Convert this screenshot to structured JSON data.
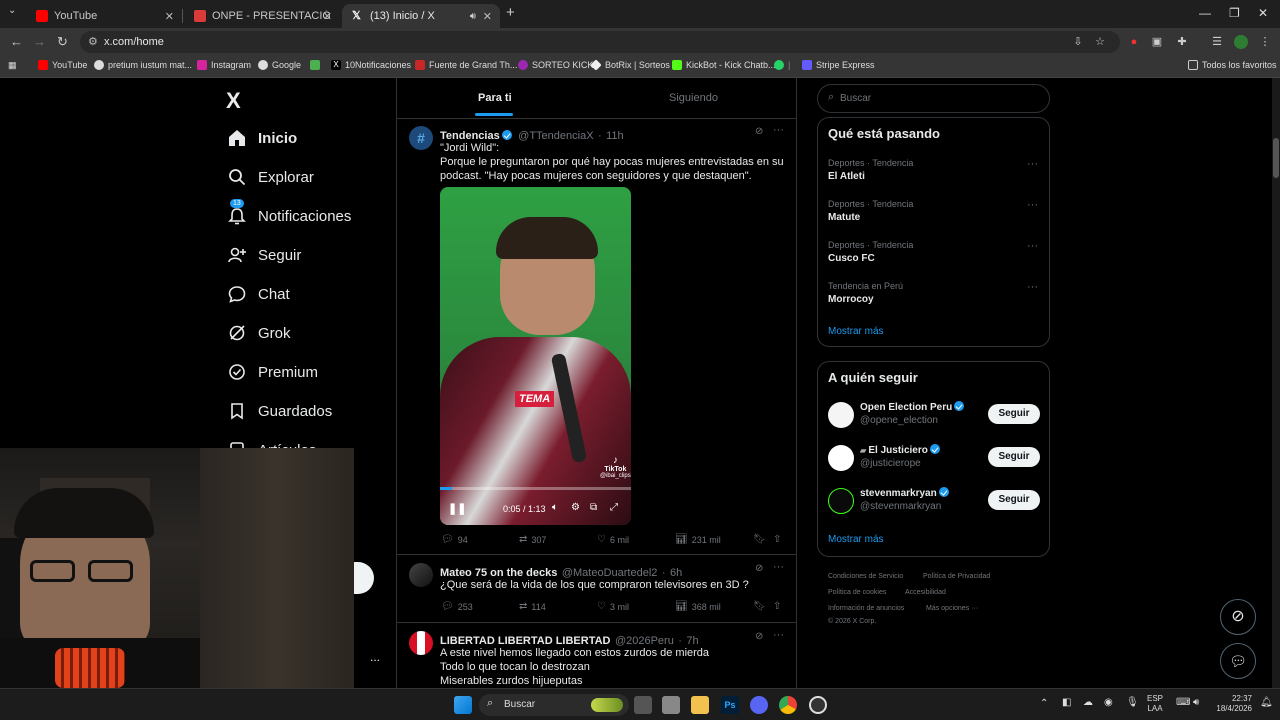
{
  "browser": {
    "tabs": [
      {
        "title": "YouTube",
        "favicon_color": "#ff0000"
      },
      {
        "title": "ONPE - PRESENTACIÓN DE RES",
        "favicon_color": "#d93a3a"
      },
      {
        "title": "(13) Inicio / X",
        "favicon_color": "#ffffff"
      }
    ],
    "new_tab": "+",
    "url": "x.com/home",
    "bookmarks": [
      "YouTube",
      "pretium iustum mat...",
      "Instagram",
      "Google",
      "10Notificaciones",
      "Fuente de Grand Th...",
      "SORTEO KICK",
      "BotRix | Sorteos",
      "KickBot - Kick Chatb...",
      "Stripe Express",
      "Todos los favoritos"
    ]
  },
  "nav": {
    "logo": "X",
    "items": [
      {
        "label": "Inicio",
        "icon": "home-icon"
      },
      {
        "label": "Explorar",
        "icon": "search-icon"
      },
      {
        "label": "Notificaciones",
        "icon": "bell-icon",
        "badge": "13"
      },
      {
        "label": "Seguir",
        "icon": "add-person-icon"
      },
      {
        "label": "Chat",
        "icon": "chat-icon"
      },
      {
        "label": "Grok",
        "icon": "grok-icon"
      },
      {
        "label": "Premium",
        "icon": "verified-icon"
      },
      {
        "label": "Guardados",
        "icon": "bookmark-icon"
      },
      {
        "label": "Artículos",
        "icon": "article-icon"
      }
    ],
    "more": "..."
  },
  "timeline": {
    "tabs": [
      "Para ti",
      "Siguiendo"
    ],
    "posts": [
      {
        "name": "Tendencias",
        "handle": "@TTendenciaX",
        "time": "11h",
        "text": [
          "\"Jordi Wild\":",
          "Porque le preguntaron por qué hay pocas mujeres entrevistadas en su",
          "podcast. \"Hay pocas mujeres con seguidores y que destaquen\"."
        ],
        "video": {
          "caption": "TEMA",
          "watermark": "TikTok",
          "watermark_handle": "@ibai_clips",
          "time": "0:05 / 1:13",
          "progress": 0.064
        },
        "replies": "94",
        "reposts": "307",
        "likes": "6 mil",
        "views": "231 mil"
      },
      {
        "name": "Mateo 75 on the decks",
        "handle": "@MateoDuartedel2",
        "time": "6h",
        "text": [
          "¿Que será de la vida de los que compraron televisores en 3D ?"
        ],
        "replies": "253",
        "reposts": "114",
        "likes": "3 mil",
        "views": "368 mil"
      },
      {
        "name": "LIBERTAD LIBERTAD LIBERTAD",
        "handle": "@2026Peru",
        "time": "7h",
        "text": [
          "A este nivel hemos llegado con estos zurdos de mierda",
          "Todo lo que tocan lo destrozan",
          "Miserables zurdos hijueputas"
        ]
      }
    ]
  },
  "sidebar": {
    "search_placeholder": "Buscar",
    "trending_title": "Qué está pasando",
    "trends": [
      {
        "category": "Deportes · Tendencia",
        "name": "El Atleti"
      },
      {
        "category": "Deportes · Tendencia",
        "name": "Matute"
      },
      {
        "category": "Deportes · Tendencia",
        "name": "Cusco FC"
      },
      {
        "category": "Tendencia en Perú",
        "name": "Morrocoy"
      }
    ],
    "show_more": "Mostrar más",
    "follow_title": "A quién seguir",
    "follow": [
      {
        "name": "Open Election Peru",
        "handle": "@opene_election",
        "button": "Seguir"
      },
      {
        "name": "El Justiciero",
        "handle": "@justicierope",
        "button": "Seguir"
      },
      {
        "name": "stevenmarkryan",
        "handle": "@stevenmarkryan",
        "button": "Seguir"
      }
    ],
    "follow_more": "Mostrar más",
    "footer": [
      "Condiciones de Servicio",
      "Política de Privacidad",
      "Política de cookies",
      "Accesibilidad",
      "Información de anuncios",
      "Más opciones ···",
      "© 2026 X Corp."
    ]
  },
  "taskbar": {
    "search": "Buscar",
    "lang": "ESP",
    "lang2": "LAA",
    "time": "22:37",
    "date": "18/4/2026"
  }
}
